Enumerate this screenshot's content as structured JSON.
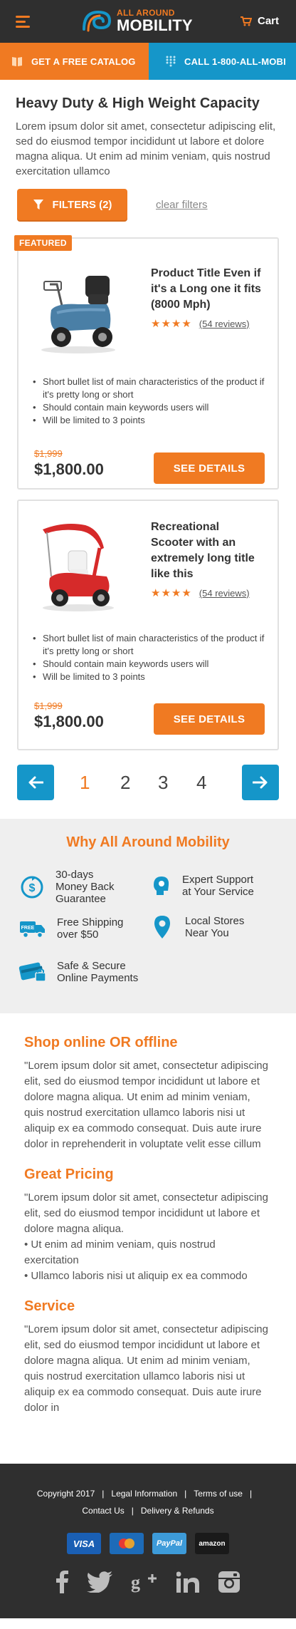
{
  "header": {
    "logo_top": "ALL AROUND",
    "logo_bottom": "MOBILITY",
    "cart_label": "Cart"
  },
  "cta": {
    "catalog_label": "GET A FREE CATALOG",
    "call_label": "CALL 1-800-ALL-MOBI"
  },
  "intro": {
    "title": "Heavy Duty & High Weight Capacity",
    "text": "Lorem ipsum dolor sit amet, consectetur adipiscing elit, sed do eiusmod tempor incididunt ut labore et dolore magna aliqua. Ut enim ad minim veniam, quis nostrud exercitation ullamco"
  },
  "filters": {
    "button_label": "FILTERS (2)",
    "clear_label": "clear filters"
  },
  "products": [
    {
      "badge": "FEATURED",
      "title": "Product Title Even if it's a Long one it fits (8000 Mph)",
      "stars": "★★★★",
      "reviews": "(54 reviews)",
      "bullets": [
        "Short bullet list of main characteristics of the product if it's pretty long or short",
        "Should contain main keywords users will",
        "Will be limited to 3 points"
      ],
      "old_price": "$1,999",
      "price": "$1,800.00",
      "button": "SEE DETAILS",
      "image_color": "#4a7fa6"
    },
    {
      "title": "Recreational Scooter with an extremely long title like this",
      "stars": "★★★★",
      "reviews": "(54 reviews)",
      "bullets": [
        "Short bullet list of main characteristics of the product if it's pretty long or short",
        "Should contain main keywords users will",
        "Will be limited to 3 points"
      ],
      "old_price": "$1,999",
      "price": "$1,800.00",
      "button": "SEE DETAILS",
      "image_color": "#d62a2a"
    }
  ],
  "pagination": {
    "pages": [
      "1",
      "2",
      "3",
      "4"
    ],
    "current": "1"
  },
  "why": {
    "title": "Why All Around Mobility",
    "items": [
      {
        "icon": "money-back-icon",
        "label_lines": [
          "30-days",
          "Money Back",
          "Guarantee"
        ]
      },
      {
        "icon": "expert-support-icon",
        "label_lines": [
          "Expert Support",
          "at Your Service"
        ]
      },
      {
        "icon": "free-shipping-icon",
        "label_lines": [
          "Free Shipping",
          "over $50"
        ]
      },
      {
        "icon": "location-pin-icon",
        "label_lines": [
          "Local Stores",
          "Near You"
        ]
      },
      {
        "icon": "secure-payment-icon",
        "label_lines": [
          "Safe & Secure",
          "Online Payments"
        ]
      }
    ]
  },
  "sections": [
    {
      "title": "Shop online OR offline",
      "lines": [
        "\"Lorem ipsum dolor sit amet, consectetur adipiscing elit, sed do eiusmod tempor incididunt ut labore et dolore magna aliqua. Ut enim ad minim veniam, quis nostrud exercitation ullamco laboris nisi ut aliquip ex ea commodo consequat. Duis aute irure dolor in reprehenderit in voluptate velit esse cillum"
      ]
    },
    {
      "title": "Great Pricing",
      "lines": [
        "\"Lorem ipsum dolor sit amet, consectetur adipiscing elit, sed do eiusmod tempor incididunt ut labore et dolore magna aliqua.",
        "• Ut enim ad minim veniam, quis nostrud exercitation",
        "• Ullamco laboris nisi ut aliquip ex ea commodo"
      ]
    },
    {
      "title": "Service",
      "lines": [
        "\"Lorem ipsum dolor sit amet, consectetur adipiscing elit, sed do eiusmod tempor incididunt ut labore et dolore magna aliqua. Ut enim ad minim veniam, quis nostrud exercitation ullamco laboris nisi ut aliquip ex ea commodo consequat. Duis aute irure dolor in"
      ]
    }
  ],
  "footer": {
    "links_row1": [
      "Copyright 2017",
      "Legal Information",
      "Terms of use"
    ],
    "links_row2": [
      "Contact Us",
      "Delivery  & Refunds"
    ],
    "payments": [
      "VISA",
      "MasterCard",
      "PayPal",
      "amazon"
    ],
    "socials": [
      "facebook-icon",
      "twitter-icon",
      "google-plus-icon",
      "linkedin-icon",
      "instagram-icon"
    ]
  },
  "colors": {
    "accent": "#f07a22",
    "secondary": "#1596c9",
    "dark": "#2f2f2f"
  }
}
